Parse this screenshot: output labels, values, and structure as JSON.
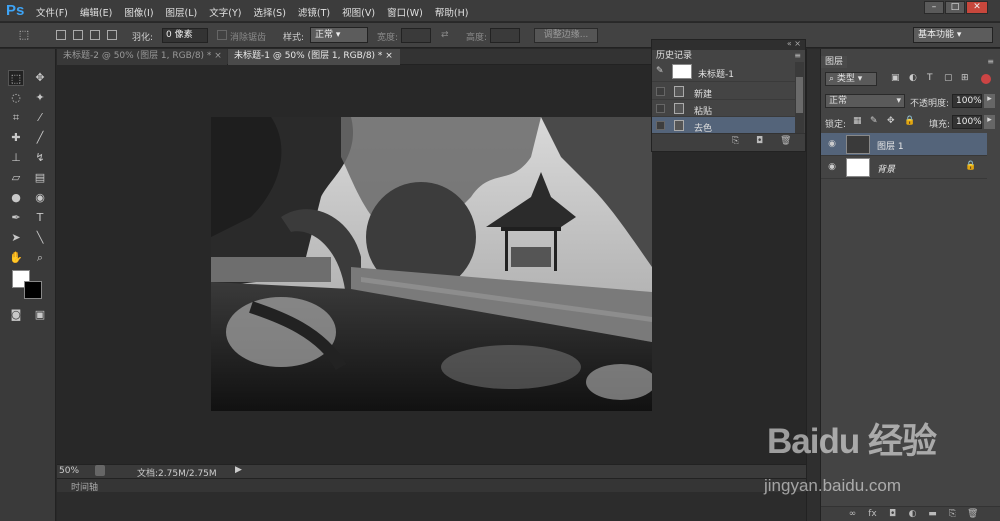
{
  "app": {
    "logo": "Ps",
    "menu": [
      "文件(F)",
      "编辑(E)",
      "图像(I)",
      "图层(L)",
      "文字(Y)",
      "选择(S)",
      "滤镜(T)",
      "视图(V)",
      "窗口(W)",
      "帮助(H)"
    ],
    "window_buttons": [
      "–",
      "□",
      "✕"
    ]
  },
  "options": {
    "feather_label": "羽化:",
    "feather_value": "0 像素",
    "antialias_label": "消除锯齿",
    "style_label": "样式:",
    "style_value": "正常",
    "width_label": "宽度:",
    "height_label": "高度:",
    "refine_button": "调整边缘...",
    "workspace": "基本功能"
  },
  "tabs": [
    {
      "label": "未标题-2 @ 50% (图层 1, RGB/8) *"
    },
    {
      "label": "未标题-1 @ 50% (图层 1, RGB/8) *"
    }
  ],
  "status": {
    "zoom": "50%",
    "doc": "文档:2.75M/2.75M",
    "timeline": "时间轴"
  },
  "history": {
    "title": "历史记录",
    "snapshot": "未标题-1",
    "items": [
      {
        "label": "新建"
      },
      {
        "label": "粘贴"
      },
      {
        "label": "去色"
      }
    ]
  },
  "layers": {
    "title": "图层",
    "filter_kind": "类型",
    "blend_mode": "正常",
    "opacity_label": "不透明度:",
    "opacity_value": "100%",
    "lock_label": "锁定:",
    "fill_label": "填充:",
    "fill_value": "100%",
    "items": [
      {
        "name": "图层 1"
      },
      {
        "name": "背景"
      }
    ]
  },
  "watermark": {
    "brand": "Baidu 经验",
    "url": "jingyan.baidu.com"
  },
  "colors": {
    "accent": "#3ea4f6",
    "selected_row": "#54647a",
    "panel_bg": "#444444",
    "workspace_bg": "#282828"
  }
}
